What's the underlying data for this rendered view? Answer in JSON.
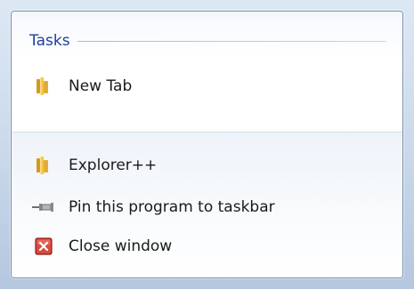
{
  "jump_list": {
    "section_title": "Tasks",
    "tasks": [
      {
        "label": "New Tab",
        "icon": "folder-icon"
      }
    ],
    "actions": [
      {
        "label": "Explorer++",
        "icon": "folder-icon"
      },
      {
        "label": "Pin this program to taskbar",
        "icon": "pin-icon"
      },
      {
        "label": "Close window",
        "icon": "close-window-icon"
      }
    ]
  },
  "colors": {
    "section_title": "#1e3f9c",
    "folder": "#e8b537",
    "close_red": "#c9342c"
  }
}
